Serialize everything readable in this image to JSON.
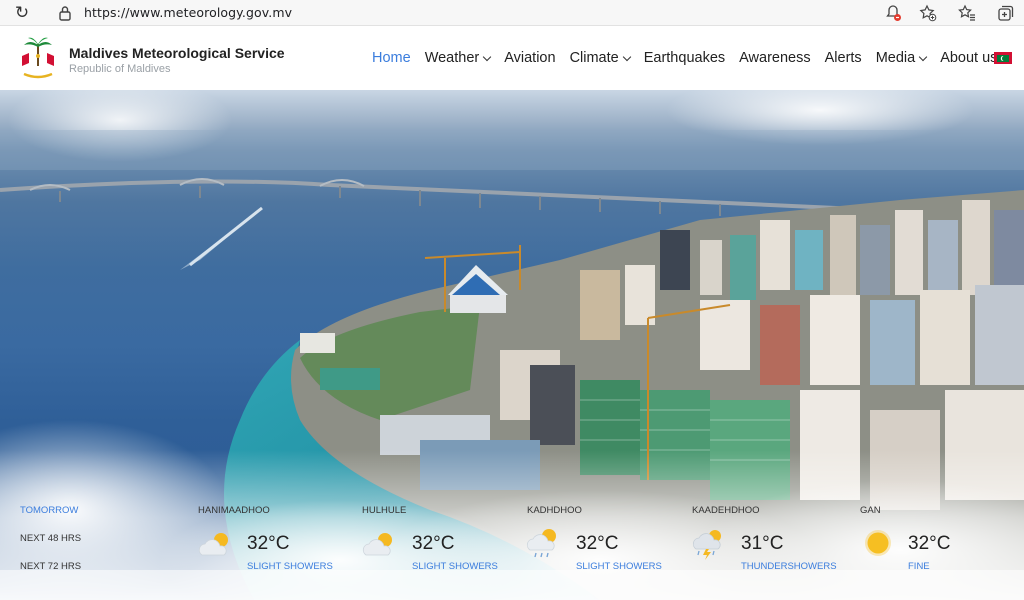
{
  "browser": {
    "url": "https://www.meteorology.gov.mv"
  },
  "header": {
    "org_name": "Maldives Meteorological Service",
    "org_sub": "Republic of Maldives"
  },
  "nav": {
    "items": [
      {
        "label": "Home",
        "active": true,
        "dropdown": false
      },
      {
        "label": "Weather",
        "active": false,
        "dropdown": true
      },
      {
        "label": "Aviation",
        "active": false,
        "dropdown": false
      },
      {
        "label": "Climate",
        "active": false,
        "dropdown": true
      },
      {
        "label": "Earthquakes",
        "active": false,
        "dropdown": false
      },
      {
        "label": "Awareness",
        "active": false,
        "dropdown": false
      },
      {
        "label": "Alerts",
        "active": false,
        "dropdown": false
      },
      {
        "label": "Media",
        "active": false,
        "dropdown": true
      },
      {
        "label": "About us",
        "active": false,
        "dropdown": false
      }
    ]
  },
  "forecast": {
    "tabs": [
      "TOMORROW",
      "NEXT 48 HRS",
      "NEXT 72 HRS"
    ],
    "active_tab": "TOMORROW",
    "stations": [
      {
        "name": "HANIMAADHOO",
        "temp": "32°C",
        "condition": "SLIGHT SHOWERS",
        "icon": "sun-cloud-icon"
      },
      {
        "name": "HULHULE",
        "temp": "32°C",
        "condition": "SLIGHT SHOWERS",
        "icon": "sun-cloud-icon"
      },
      {
        "name": "KADHDHOO",
        "temp": "32°C",
        "condition": "SLIGHT SHOWERS",
        "icon": "sun-cloud-rain-icon"
      },
      {
        "name": "KAADEHDHOO",
        "temp": "31°C",
        "condition": "THUNDERSHOWERS",
        "icon": "thunder-cloud-icon"
      },
      {
        "name": "GAN",
        "temp": "32°C",
        "condition": "FINE",
        "icon": "sun-icon"
      }
    ]
  },
  "colors": {
    "accent": "#3b7ddd",
    "flag_red": "#d21034",
    "flag_green": "#007e3a"
  }
}
